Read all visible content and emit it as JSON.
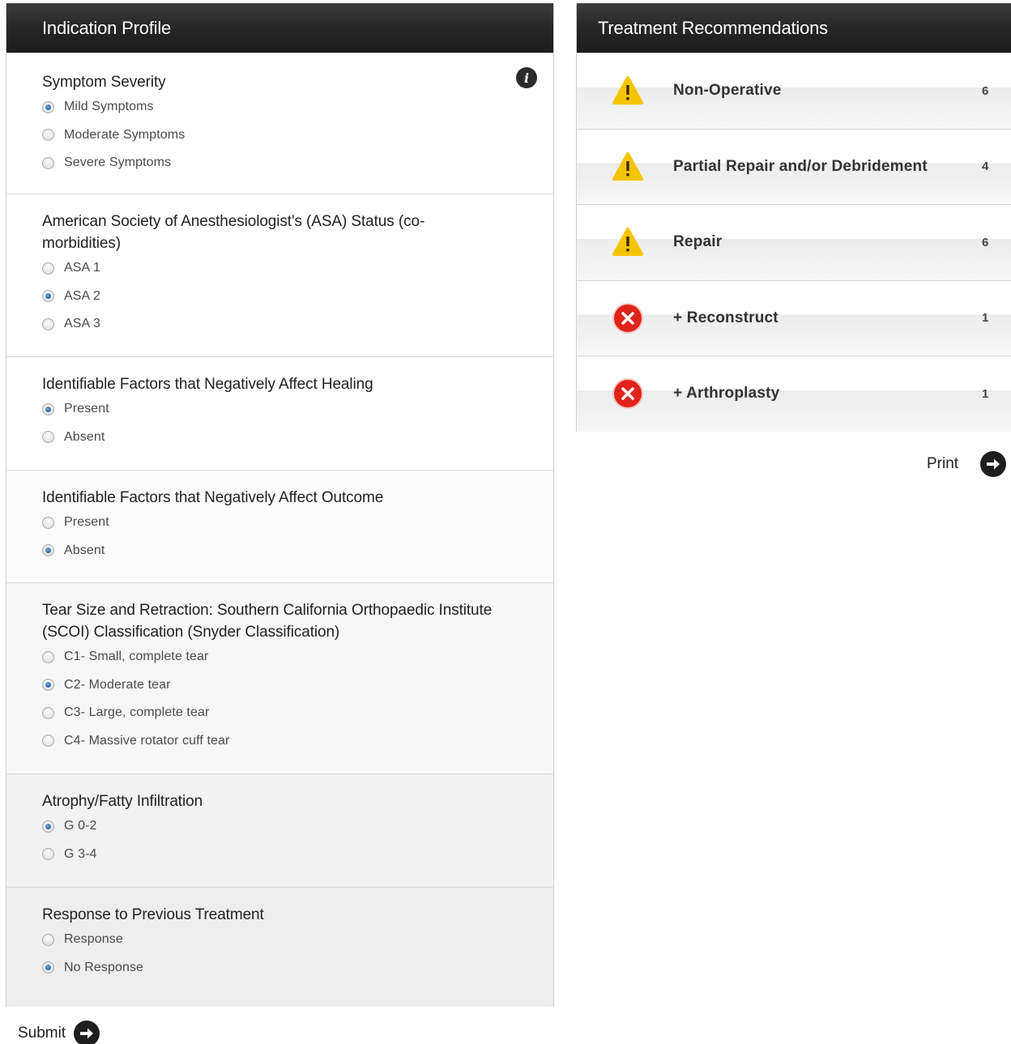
{
  "indication_profile": {
    "title": "Indication Profile",
    "info_icon": "info-icon",
    "sections": [
      {
        "title": "Symptom Severity",
        "options": [
          {
            "label": "Mild Symptoms",
            "selected": true
          },
          {
            "label": "Moderate Symptoms",
            "selected": false
          },
          {
            "label": "Severe Symptoms",
            "selected": false
          }
        ]
      },
      {
        "title": "American Society of Anesthesiologist's (ASA) Status (co-morbidities)",
        "options": [
          {
            "label": "ASA 1",
            "selected": false
          },
          {
            "label": "ASA 2",
            "selected": true
          },
          {
            "label": "ASA 3",
            "selected": false
          }
        ]
      },
      {
        "title": "Identifiable Factors that Negatively Affect Healing",
        "options": [
          {
            "label": "Present",
            "selected": true
          },
          {
            "label": "Absent",
            "selected": false
          }
        ]
      },
      {
        "title": "Identifiable Factors that Negatively Affect Outcome",
        "options": [
          {
            "label": "Present",
            "selected": false
          },
          {
            "label": "Absent",
            "selected": true
          }
        ]
      },
      {
        "title": "Tear Size and Retraction: Southern California Orthopaedic Institute (SCOI) Classification (Snyder Classification)",
        "options": [
          {
            "label": "C1- Small, complete tear",
            "selected": false
          },
          {
            "label": "C2- Moderate tear",
            "selected": true
          },
          {
            "label": "C3- Large, complete tear",
            "selected": false
          },
          {
            "label": "C4- Massive rotator cuff tear",
            "selected": false
          }
        ]
      },
      {
        "title": "Atrophy/Fatty Infiltration",
        "options": [
          {
            "label": "G 0-2",
            "selected": true
          },
          {
            "label": "G 3-4",
            "selected": false
          }
        ]
      },
      {
        "title": "Response to Previous Treatment",
        "options": [
          {
            "label": "Response",
            "selected": false
          },
          {
            "label": "No Response",
            "selected": true
          }
        ]
      }
    ],
    "submit_label": "Submit"
  },
  "treatment_recommendations": {
    "title": "Treatment Recommendations",
    "items": [
      {
        "icon": "warning-icon",
        "label": "Non-Operative",
        "count": "6"
      },
      {
        "icon": "warning-icon",
        "label": "Partial Repair and/or Debridement",
        "count": "4"
      },
      {
        "icon": "warning-icon",
        "label": "Repair",
        "count": "6"
      },
      {
        "icon": "error-icon",
        "label": "+ Reconstruct",
        "count": "1"
      },
      {
        "icon": "error-icon",
        "label": "+ Arthroplasty",
        "count": "1"
      }
    ],
    "print_label": "Print"
  },
  "colors": {
    "header_bg": "#262626",
    "warning": "#f5c400",
    "error": "#e0231b",
    "radio_checked": "#1c4f86"
  }
}
